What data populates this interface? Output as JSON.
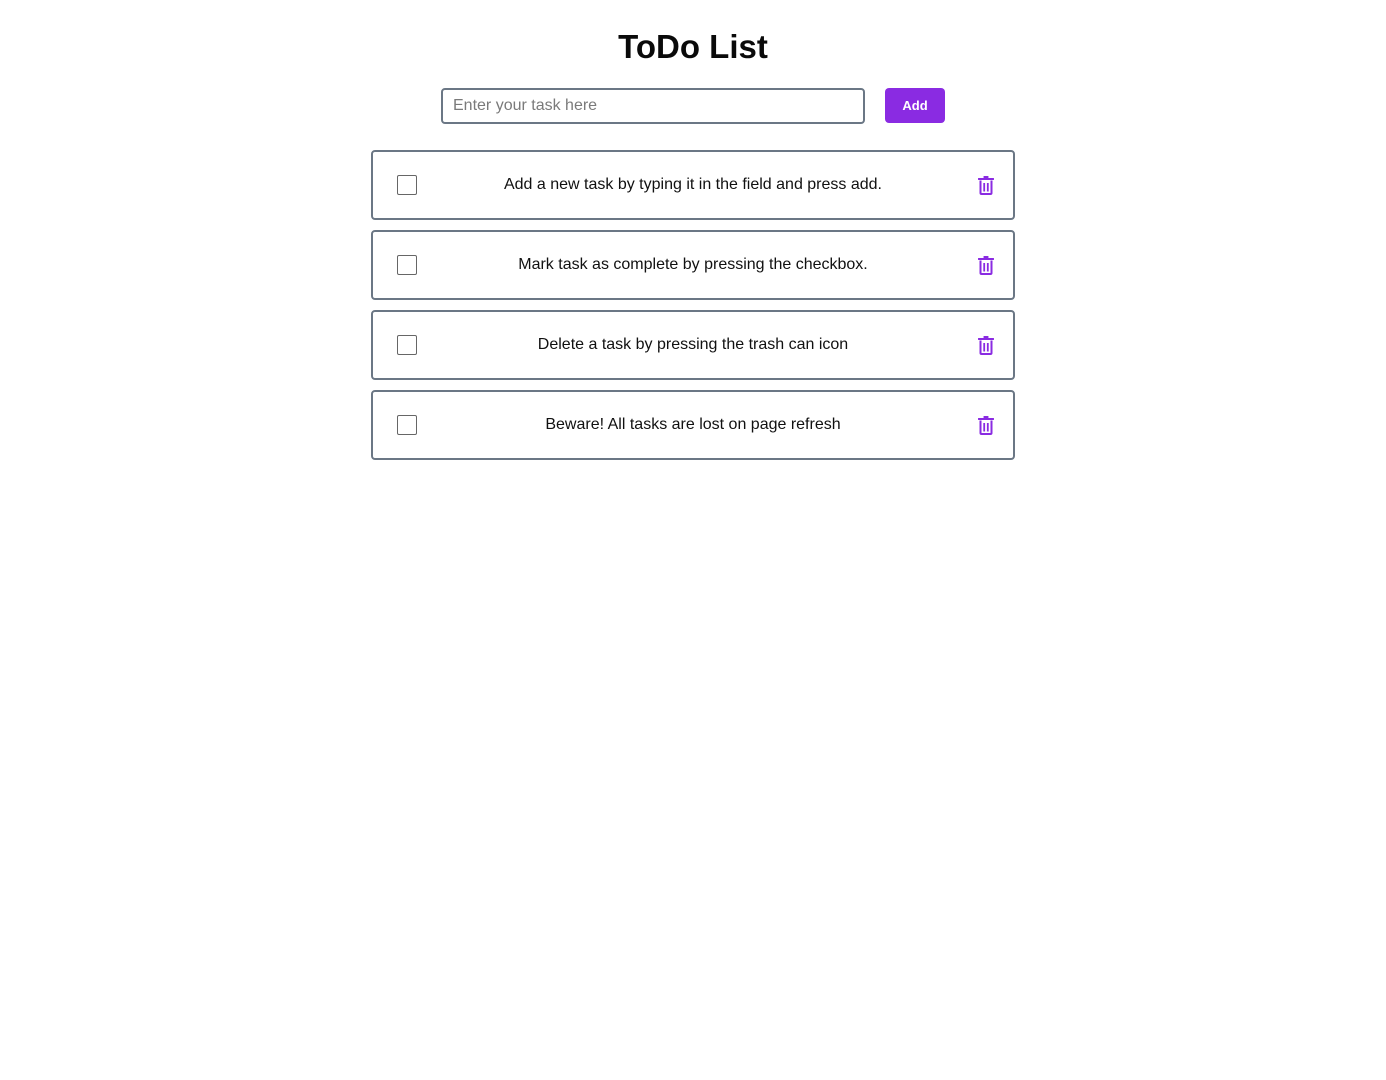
{
  "header": {
    "title": "ToDo List"
  },
  "form": {
    "input_value": "",
    "input_placeholder": "Enter your task here",
    "add_label": "Add"
  },
  "tasks": [
    {
      "text": "Add a new task by typing it in the field and press add.",
      "completed": false
    },
    {
      "text": "Mark task as complete by pressing the checkbox.",
      "completed": false
    },
    {
      "text": "Delete a task by pressing the trash can icon",
      "completed": false
    },
    {
      "text": "Beware! All tasks are lost on page refresh",
      "completed": false
    }
  ],
  "icons": {
    "delete": "trash-icon"
  },
  "colors": {
    "accent": "#8a2be2",
    "border": "#6b7785",
    "text": "#111111",
    "background": "#ffffff"
  }
}
